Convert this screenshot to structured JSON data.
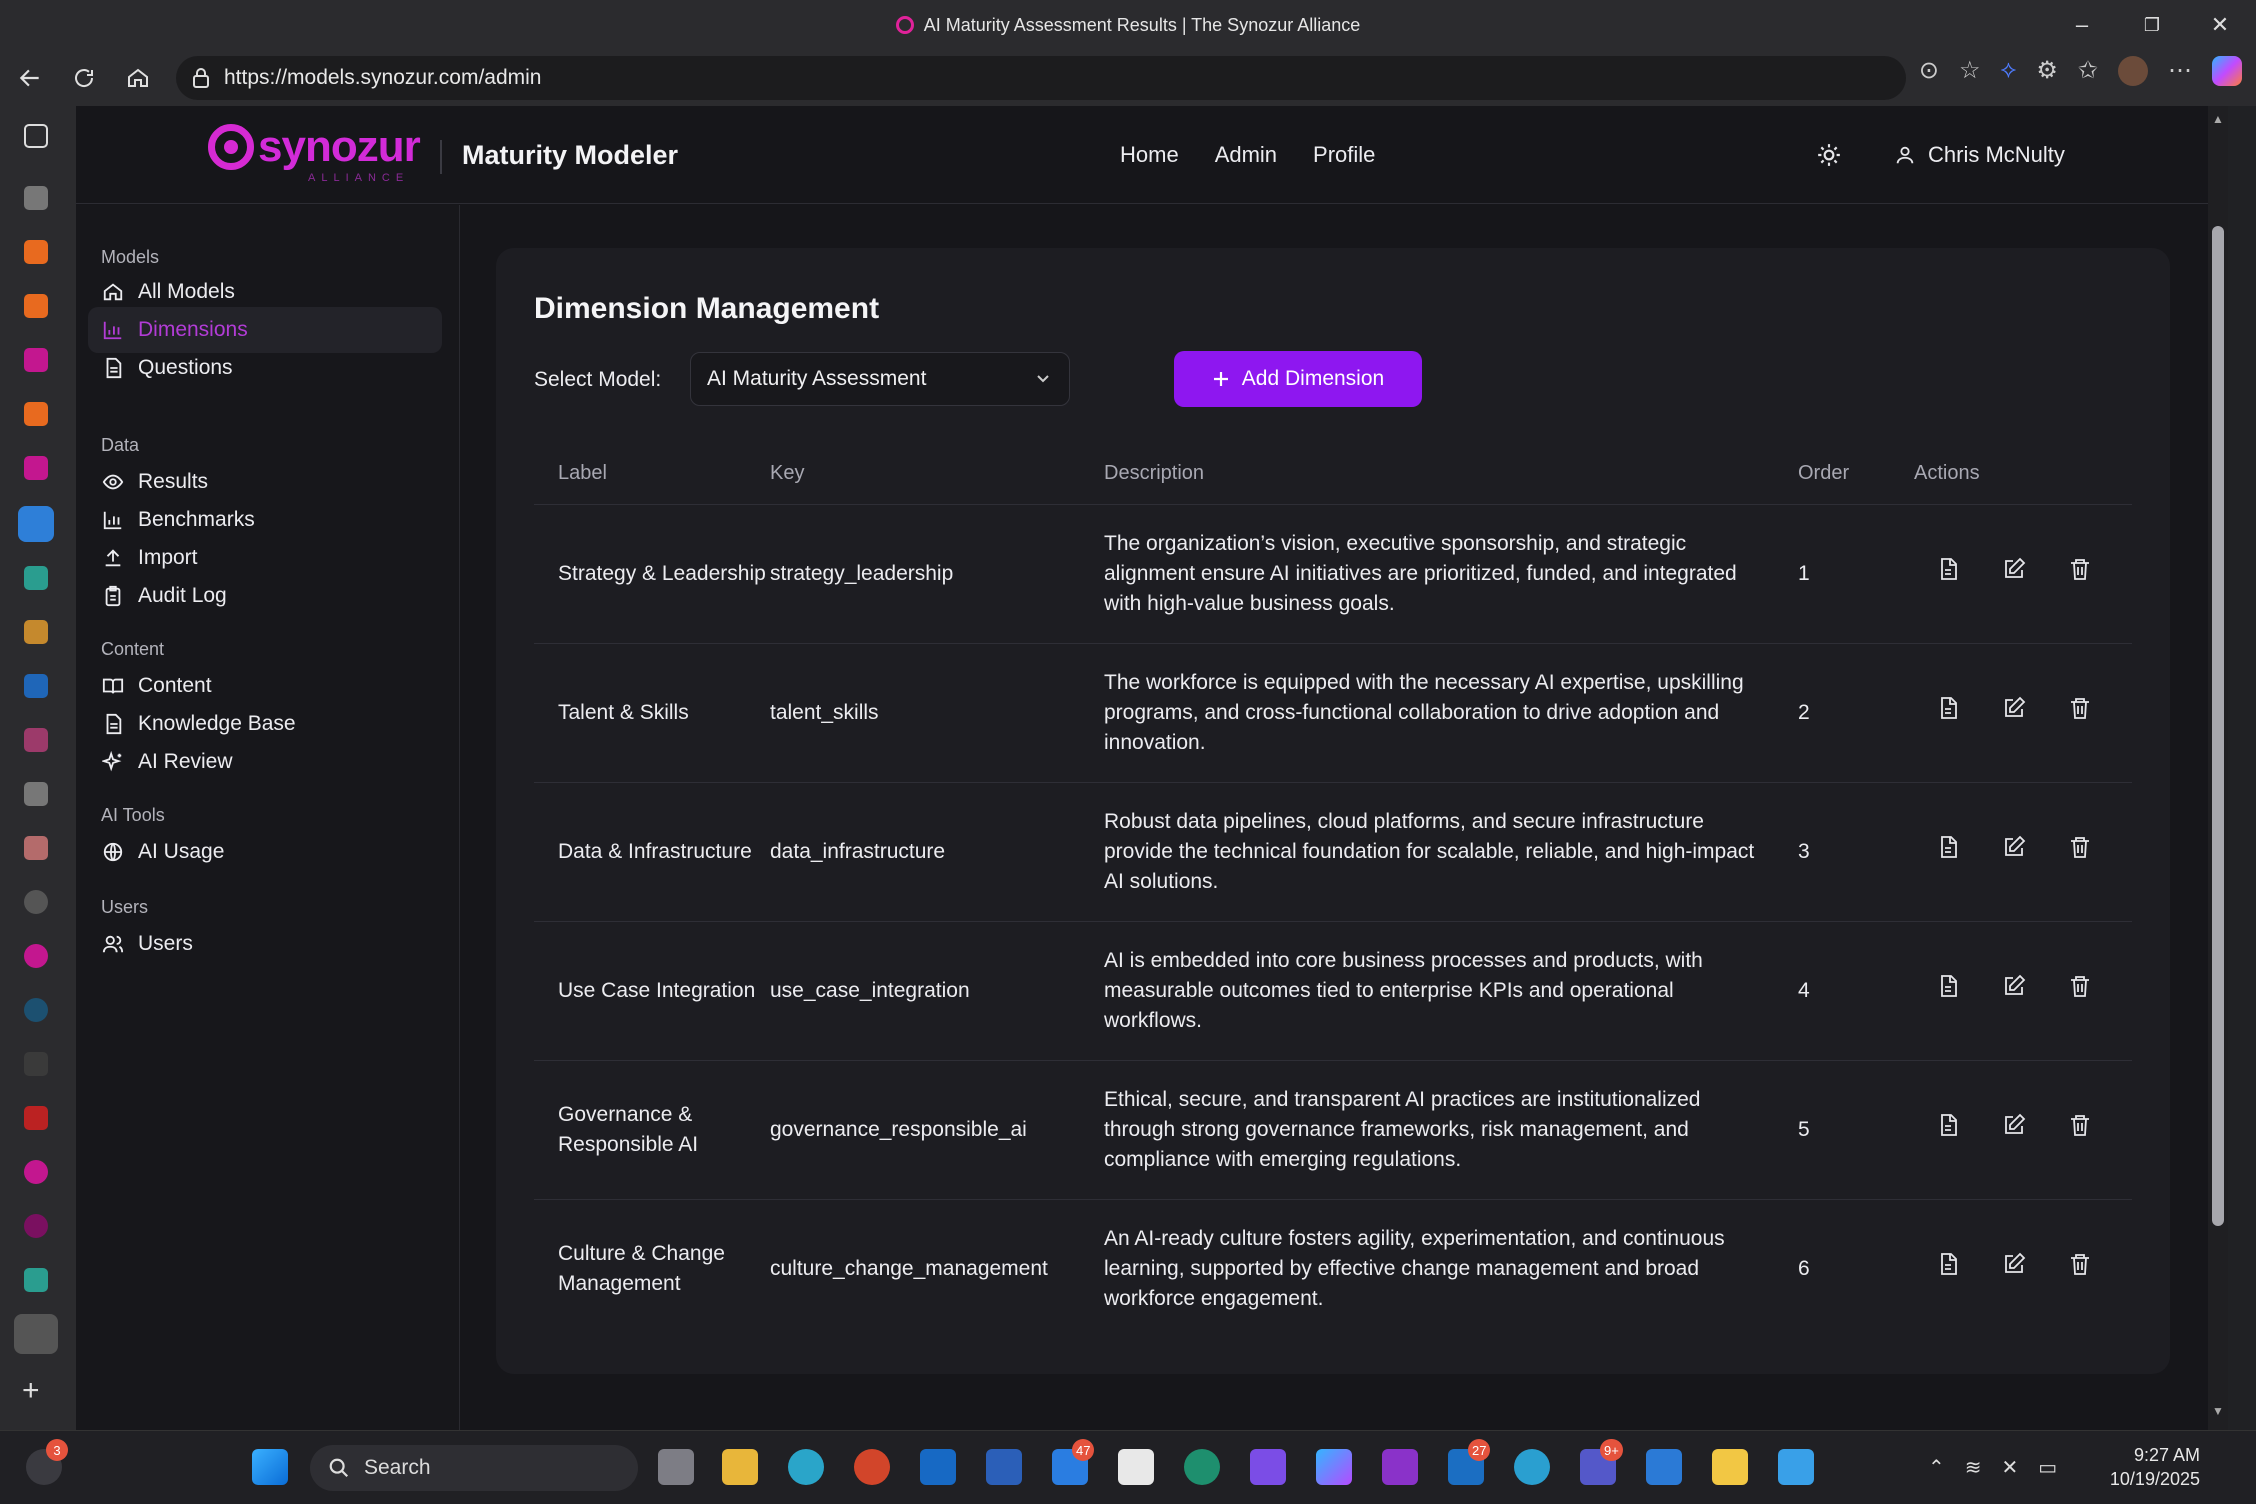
{
  "browser": {
    "window_title": "AI Maturity Assessment Results | The Synozur Alliance",
    "url": "https://models.synozur.com/admin",
    "window_controls": {
      "minimize": "–",
      "restore": "❐",
      "close": "✕"
    },
    "url_icons": [
      "⊙",
      "☆",
      "⟡",
      "⚙",
      "✩",
      "⋯"
    ]
  },
  "app": {
    "logo_text": "synozur",
    "logo_subtext": "ALLIANCE",
    "brand_title": "Maturity Modeler",
    "nav": [
      {
        "label": "Home"
      },
      {
        "label": "Admin"
      },
      {
        "label": "Profile"
      }
    ],
    "user_name": "Chris McNulty"
  },
  "sidebar": {
    "sections": [
      {
        "label": "Models",
        "items": [
          {
            "label": "All Models",
            "icon": "home-icon"
          },
          {
            "label": "Dimensions",
            "icon": "bar-chart-icon",
            "active": true
          },
          {
            "label": "Questions",
            "icon": "document-icon"
          }
        ]
      },
      {
        "label": "Data",
        "items": [
          {
            "label": "Results",
            "icon": "eye-icon"
          },
          {
            "label": "Benchmarks",
            "icon": "bar-chart-icon"
          },
          {
            "label": "Import",
            "icon": "upload-icon"
          },
          {
            "label": "Audit Log",
            "icon": "clipboard-icon"
          }
        ]
      },
      {
        "label": "Content",
        "items": [
          {
            "label": "Content",
            "icon": "book-icon"
          },
          {
            "label": "Knowledge Base",
            "icon": "document-icon"
          },
          {
            "label": "AI Review",
            "icon": "sparkle-icon"
          }
        ]
      },
      {
        "label": "AI Tools",
        "items": [
          {
            "label": "AI Usage",
            "icon": "globe-icon"
          }
        ]
      },
      {
        "label": "Users",
        "items": [
          {
            "label": "Users",
            "icon": "users-icon"
          }
        ]
      }
    ]
  },
  "main": {
    "title": "Dimension Management",
    "select_label": "Select Model:",
    "selected_model": "AI Maturity Assessment",
    "add_button": "Add Dimension",
    "table": {
      "columns": [
        "Label",
        "Key",
        "Description",
        "Order",
        "Actions"
      ],
      "rows": [
        {
          "label": "Strategy & Leadership",
          "key": "strategy_leadership",
          "description": "The organization’s vision, executive sponsorship, and strategic alignment ensure AI initiatives are prioritized, funded, and integrated with high-value business goals.",
          "order": "1"
        },
        {
          "label": "Talent & Skills",
          "key": "talent_skills",
          "description": "The workforce is equipped with the necessary AI expertise, upskilling programs, and cross-functional collaboration to drive adoption and innovation.",
          "order": "2"
        },
        {
          "label": "Data & Infrastructure",
          "key": "data_infrastructure",
          "description": "Robust data pipelines, cloud platforms, and secure infrastructure provide the technical foundation for scalable, reliable, and high-impact AI solutions.",
          "order": "3"
        },
        {
          "label": "Use Case Integration",
          "key": "use_case_integration",
          "description": "AI is embedded into core business processes and products, with measurable outcomes tied to enterprise KPIs and operational workflows.",
          "order": "4"
        },
        {
          "label": "Governance & Responsible AI",
          "key": "governance_responsible_ai",
          "description": "Ethical, secure, and transparent AI practices are institutionalized through strong governance frameworks, risk management, and compliance with emerging regulations.",
          "order": "5"
        },
        {
          "label": "Culture & Change Management",
          "key": "culture_change_management",
          "description": "An AI-ready culture fosters agility, experimentation, and continuous learning, supported by effective change management and broad workforce engagement.",
          "order": "6"
        }
      ]
    }
  },
  "taskbar": {
    "search_placeholder": "Search",
    "time": "9:27 AM",
    "date": "10/19/2025",
    "badges": {
      "notifications": "3",
      "todo": "47",
      "linkedin": "27",
      "teams": "9+"
    }
  },
  "colors": {
    "accent": "#8e17f0",
    "brand": "#d22bd8",
    "active_nav": "#b23cd6"
  }
}
